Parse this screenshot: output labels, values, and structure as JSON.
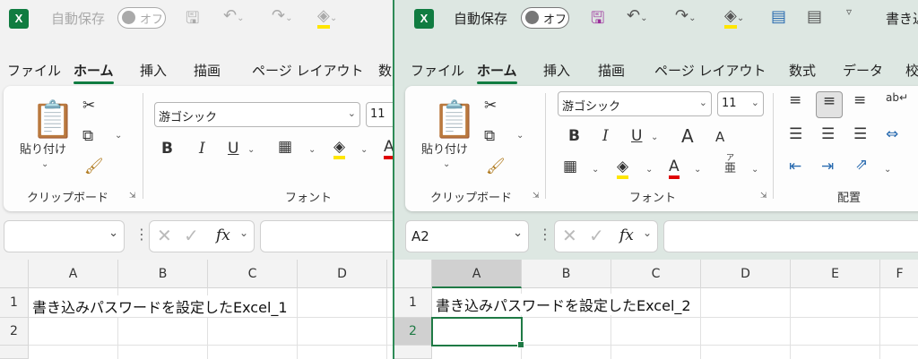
{
  "colors": {
    "excel_green": "#107c41",
    "active_window_bg": "#dde7e2",
    "inactive_window_bg": "#f2f2f2",
    "highlight_yellow": "#ffe600",
    "font_red": "#e00000"
  },
  "left": {
    "title_bar": {
      "autosave_label": "自動保存",
      "autosave_state": "オフ"
    },
    "tabs": [
      "ファイル",
      "ホーム",
      "挿入",
      "描画",
      "ページ レイアウト",
      "数"
    ],
    "ribbon": {
      "paste_label": "貼り付け",
      "clipboard_label": "クリップボード",
      "font_group_label": "フォント",
      "font_name": "游ゴシック",
      "font_size": "11",
      "bold": "B",
      "italic": "I",
      "underline": "U",
      "font_color_letter": "A"
    },
    "formula_bar": {
      "name_box": "",
      "fx": "fx"
    },
    "columns": [
      "A",
      "B",
      "C",
      "D"
    ],
    "rows": [
      "1",
      "2"
    ],
    "cell_a1": "書き込みパスワードを設定したExcel_1"
  },
  "right": {
    "title_bar": {
      "autosave_label": "自動保存",
      "autosave_state": "オフ",
      "title": "書き込"
    },
    "tabs": [
      "ファイル",
      "ホーム",
      "挿入",
      "描画",
      "ページ レイアウト",
      "数式",
      "データ",
      "校"
    ],
    "ribbon": {
      "paste_label": "貼り付け",
      "clipboard_label": "クリップボード",
      "font_group_label": "フォント",
      "alignment_group_label": "配置",
      "font_name": "游ゴシック",
      "font_size": "11",
      "bold": "B",
      "italic": "I",
      "underline": "U",
      "grow_font": "A",
      "shrink_font": "A",
      "font_color_letter": "A",
      "furigana_top": "ア",
      "furigana_main": "亜"
    },
    "formula_bar": {
      "name_box": "A2",
      "fx": "fx"
    },
    "columns": [
      "A",
      "B",
      "C",
      "D",
      "E",
      "F"
    ],
    "rows": [
      "1",
      "2"
    ],
    "cell_a1": "書き込みパスワードを設定したExcel_2"
  }
}
